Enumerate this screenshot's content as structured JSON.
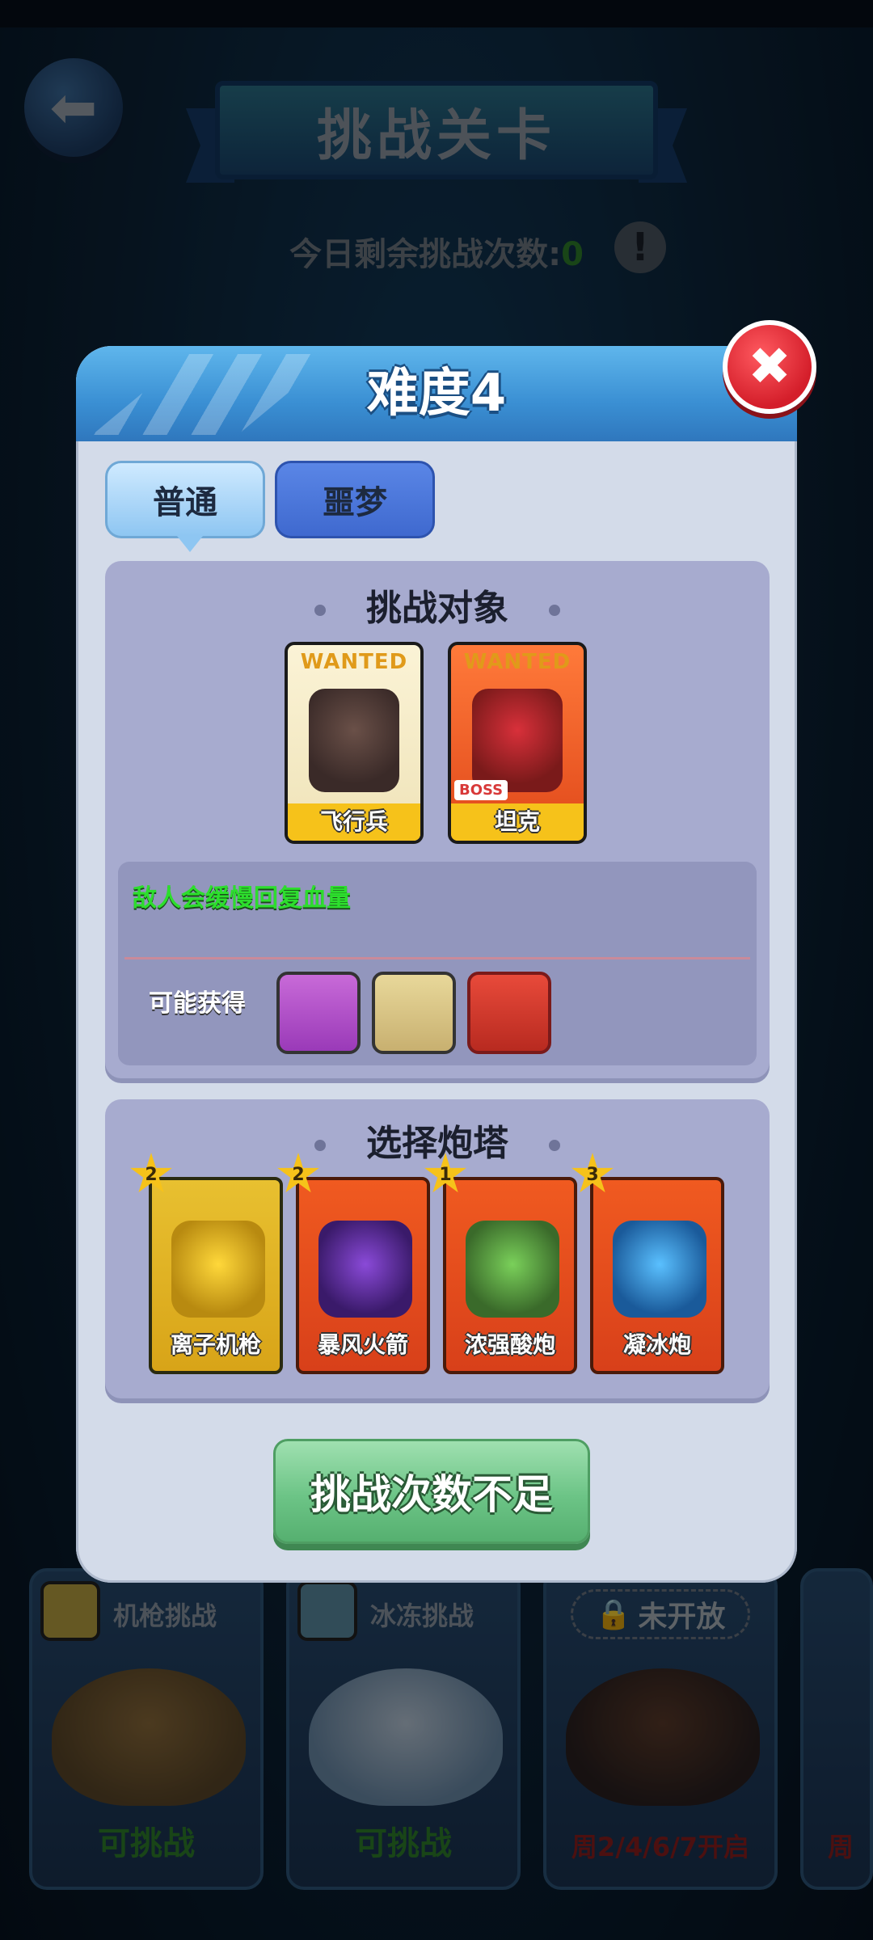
{
  "header": {
    "title": "挑战关卡",
    "remaining_label": "今日剩余挑战次数:",
    "remaining_count": "0",
    "info_symbol": "!",
    "back_symbol": "⬅"
  },
  "challenges": [
    {
      "name": "机枪挑战",
      "status": "可挑战",
      "status_color": "#2f7f2a"
    },
    {
      "name": "冰冻挑战",
      "status": "可挑战",
      "status_color": "#2f7f2a"
    },
    {
      "lock_label": "未开放",
      "status": "周2/4/6/7开启",
      "status_color": "#8a1e1e"
    },
    {
      "status": "周"
    }
  ],
  "modal": {
    "title": "难度4",
    "close_symbol": "✖",
    "tabs": [
      {
        "label": "普通",
        "active": true
      },
      {
        "label": "噩梦",
        "active": false
      }
    ],
    "targets": {
      "title": "挑战对象",
      "enemies": [
        {
          "wanted": "WANTED",
          "name": "飞行兵"
        },
        {
          "wanted": "WANTED",
          "name": "坦克",
          "tag": "BOSS"
        }
      ],
      "note": "敌人会缓慢回复血量",
      "reward_label": "可能获得"
    },
    "towers": {
      "title": "选择炮塔",
      "items": [
        {
          "name": "离子机枪",
          "stars": "2"
        },
        {
          "name": "暴风火箭",
          "stars": "2"
        },
        {
          "name": "浓强酸炮",
          "stars": "1"
        },
        {
          "name": "凝冰炮",
          "stars": "3"
        }
      ]
    },
    "cta_label": "挑战次数不足"
  },
  "colors": {
    "accent_blue": "#3a8fd3",
    "close_red": "#d41e2a",
    "note_green": "#2dde2d",
    "cta_green": "#6cc486"
  }
}
